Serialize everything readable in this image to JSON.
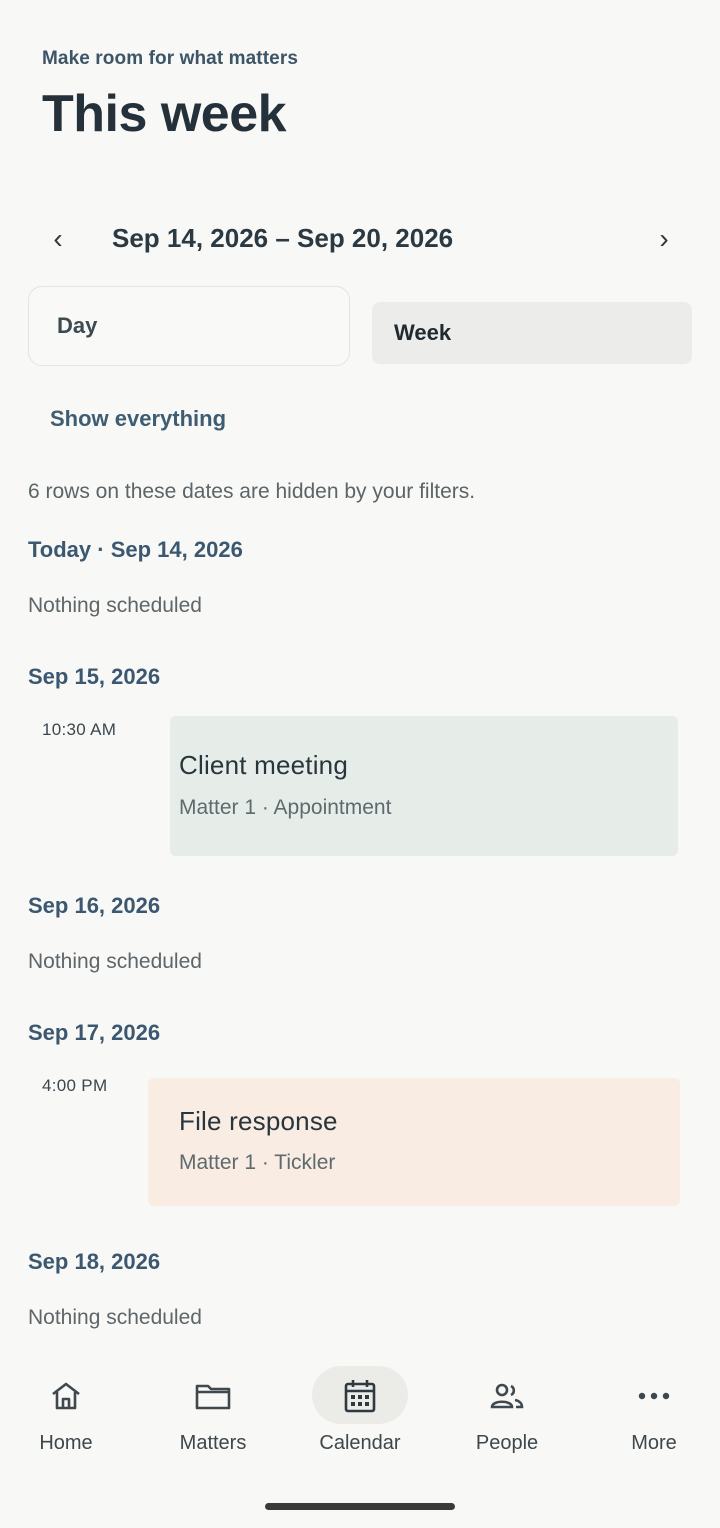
{
  "header": {
    "subtitle": "Make room for what matters",
    "title": "This week"
  },
  "range": {
    "prev_icon": "chevron-left-icon",
    "next_icon": "chevron-right-icon",
    "prev_glyph": "‹",
    "next_glyph": "›",
    "label": "Sep 14, 2026 – Sep 20, 2026"
  },
  "view_toggle": {
    "day_label": "Day",
    "week_label": "Week",
    "selected": "Week"
  },
  "filters": {
    "show_everything_label": "Show everything",
    "hidden_note": "6 rows on these dates are hidden by your filters."
  },
  "days": [
    {
      "heading": "Today · Sep 14, 2026",
      "empty_text": "Nothing scheduled"
    },
    {
      "heading": "Sep 15, 2026",
      "event": {
        "time": "10:30 AM",
        "title": "Client meeting",
        "meta": "Matter 1 · Appointment",
        "color": "#e6ede9"
      }
    },
    {
      "heading": "Sep 16, 2026",
      "empty_text": "Nothing scheduled"
    },
    {
      "heading": "Sep 17, 2026",
      "event": {
        "time": "4:00 PM",
        "title": "File response",
        "meta": "Matter 1 · Tickler",
        "color": "#f8ece3"
      }
    },
    {
      "heading": "Sep 18, 2026",
      "empty_text": "Nothing scheduled"
    }
  ],
  "bottom_nav": [
    {
      "label": "Home",
      "icon": "home-icon",
      "active": false
    },
    {
      "label": "Matters",
      "icon": "folder-icon",
      "active": false
    },
    {
      "label": "Calendar",
      "icon": "calendar-icon",
      "active": true
    },
    {
      "label": "People",
      "icon": "people-icon",
      "active": false
    },
    {
      "label": "More",
      "icon": "more-horizontal-icon",
      "active": false
    }
  ],
  "colors": {
    "background": "#f8f8f6",
    "accent": "#3b5870",
    "appointment_card": "#e6ede9",
    "tickler_card": "#f8ece3"
  }
}
